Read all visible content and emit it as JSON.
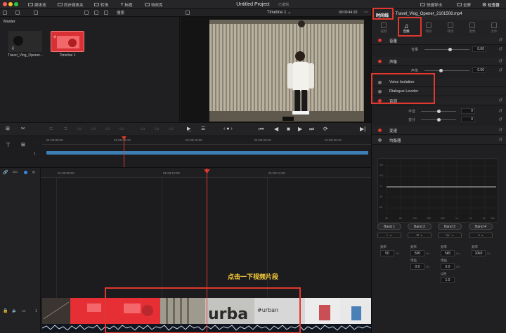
{
  "topbar": {
    "project_title": "Untitled Project",
    "project_status": "已编辑",
    "media_pool_label": "媒体池",
    "sync_bin_label": "同步媒体夹",
    "transition_label": "转场",
    "titles_label": "标题",
    "effects_label": "特效库",
    "quick_export_label": "快捷导出",
    "full_label": "全屏",
    "inspector_label": "检查器"
  },
  "toolbar2": {
    "search_label": "搜索",
    "timeline_name": "Timeline 1",
    "timecode": "00:00:44:20"
  },
  "media_pool": {
    "folder": "Master",
    "clips": [
      {
        "name": "Travel_Vlog_Opener..."
      },
      {
        "name": "Timeline 1"
      }
    ]
  },
  "mini_timeline": {
    "timecodes": [
      "01:00:08:00",
      "01:00:09:15",
      "01:00:15:05",
      "01:00:20:20",
      "01:00:26:10"
    ]
  },
  "timeline": {
    "timecodes": [
      "01:00:08:00",
      "01:00:10:00",
      "01:00:12:00"
    ],
    "caption": "点击一下视频片段",
    "track_index": "1"
  },
  "inspector": {
    "header_tab": "时间线",
    "header_file": "Travel_Vlog_Opener_2101508.mp4",
    "tabs": [
      {
        "label": "视频"
      },
      {
        "label": "音频"
      },
      {
        "label": "特效"
      },
      {
        "label": "转场"
      },
      {
        "label": "图像"
      },
      {
        "label": "文件"
      }
    ],
    "volume_section": "音量",
    "volume_label": "音量",
    "volume_value": "0.00",
    "pan_section": "声像",
    "pan_label": "声像",
    "pan_value": "0.00",
    "voice_isolation": "Voice Isolation",
    "dialogue_leveler": "Dialogue Leveler",
    "pitch_section": "音调",
    "semitone_label": "半音",
    "semitone_value": "0",
    "cents_label": "音分",
    "cents_value": "0",
    "reverse_section": "变速",
    "eq_section": "均衡器",
    "eq_y_ticks": [
      "+20",
      "+10",
      "0",
      "-10",
      "-20"
    ],
    "eq_x_ticks": [
      "30",
      "50",
      "100",
      "200",
      "500",
      "1k",
      "2k",
      "5k",
      "10k"
    ],
    "bands": [
      {
        "label": "Band 1",
        "freq_label": "频率",
        "freq": "50",
        "unit": "Hz"
      },
      {
        "label": "Band 2",
        "freq_label": "频率",
        "freq": "500",
        "unit": "Hz",
        "gain_label": "增益",
        "gain": "0.0",
        "gain_unit": "dB"
      },
      {
        "label": "Band 3",
        "freq_label": "频率",
        "freq": "5k5",
        "unit": "Hz",
        "gain_label": "增益",
        "gain": "0.0",
        "gain_unit": "dB",
        "q_label": "Q值",
        "q": "1.0"
      },
      {
        "label": "Band 4",
        "freq_label": "频率",
        "freq": "10k0",
        "unit": "Hz"
      }
    ]
  }
}
